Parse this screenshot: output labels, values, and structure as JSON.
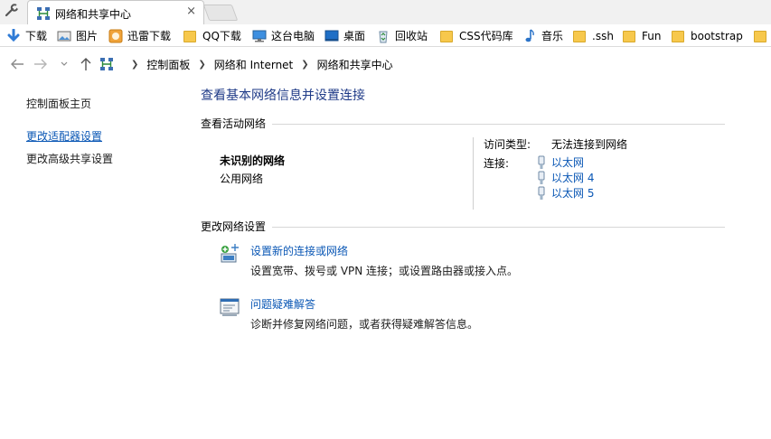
{
  "browser": {
    "tab": {
      "title": "网络和共享中心",
      "close": "×"
    },
    "bookmarks": [
      {
        "label": "下载",
        "icon": "download-arrow-icon"
      },
      {
        "label": "图片",
        "icon": "image-icon"
      },
      {
        "label": "迅雷下载",
        "icon": "thunder-app-icon"
      },
      {
        "label": "QQ下载",
        "icon": "folder-icon"
      },
      {
        "label": "这台电脑",
        "icon": "computer-icon"
      },
      {
        "label": "桌面",
        "icon": "desktop-icon"
      },
      {
        "label": "回收站",
        "icon": "recycle-bin-icon"
      },
      {
        "label": "CSS代码库",
        "icon": "folder-icon"
      },
      {
        "label": "音乐",
        "icon": "music-note-icon"
      },
      {
        "label": ".ssh",
        "icon": "folder-icon"
      },
      {
        "label": "Fun",
        "icon": "folder-icon"
      },
      {
        "label": "bootstrap",
        "icon": "folder-icon"
      }
    ]
  },
  "address": {
    "crumbs": [
      "控制面板",
      "网络和 Internet",
      "网络和共享中心"
    ]
  },
  "left_pane": {
    "links": [
      "控制面板主页",
      "更改适配器设置",
      "更改高级共享设置"
    ]
  },
  "main": {
    "title": "查看基本网络信息并设置连接",
    "active_networks": {
      "heading": "查看活动网络",
      "network_name": "未识别的网络",
      "network_type": "公用网络",
      "access_type_label": "访问类型:",
      "access_type_value": "无法连接到网络",
      "connections_label": "连接:",
      "connections": [
        "以太网",
        "以太网 4",
        "以太网 5"
      ]
    },
    "change_settings": {
      "heading": "更改网络设置",
      "tasks": [
        {
          "link": "设置新的连接或网络",
          "desc": "设置宽带、拨号或 VPN 连接；或设置路由器或接入点。",
          "icon": "new-connection-icon"
        },
        {
          "link": "问题疑难解答",
          "desc": "诊断并修复网络问题，或者获得疑难解答信息。",
          "icon": "troubleshoot-icon"
        }
      ]
    }
  },
  "colors": {
    "link": "#0a57b5",
    "title": "#1e3a87",
    "folder": "#f7c84c",
    "rule": "#d7d7d7"
  }
}
